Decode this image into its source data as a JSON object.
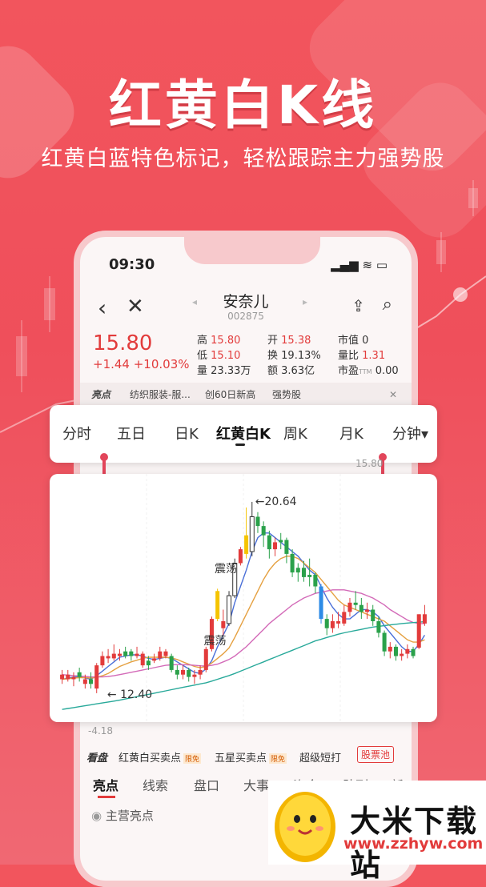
{
  "hero": {
    "title": "红黄白K线",
    "subtitle": "红黄白蓝特色标记，轻松跟踪主力强势股"
  },
  "status_bar": {
    "time": "09:30",
    "icons": "▂▄▆ ≋ ▭"
  },
  "nav": {
    "back_icon": "‹",
    "close_icon": "✕",
    "stock_name": "安奈儿",
    "stock_code": "002875",
    "prev_icon": "◂",
    "next_icon": "▸",
    "share_icon": "⇪",
    "search_icon": "⌕"
  },
  "quote": {
    "price": "15.80",
    "change": "+1.44 +10.03%",
    "high_label": "高",
    "high": "15.80",
    "low_label": "低",
    "low": "15.10",
    "volume_label": "量",
    "volume": "23.33万",
    "open_label": "开",
    "open": "15.38",
    "turnover_label": "换",
    "turnover": "19.13%",
    "amount_label": "额",
    "amount": "3.63亿",
    "mktval_label": "市值",
    "mktval": "0",
    "volratio_label": "量比",
    "volratio": "1.31",
    "pe_label": "市盈",
    "pe_sub": "TTM",
    "pe": "0.00"
  },
  "tags": {
    "highlight": "亮点",
    "tag1": "纺织服装-服...",
    "tag2": "创60日新高",
    "tag3": "强势股",
    "close_icon": "✕"
  },
  "period_tabs": [
    "分时",
    "五日",
    "日K",
    "红黄白K",
    "周K",
    "月K",
    "分钟▾"
  ],
  "chart_edge_labels": {
    "top_right": "15.80",
    "bottom_left": "-4.18"
  },
  "chart_data": {
    "type": "candlestick",
    "annotations": [
      {
        "text": "←20.64"
      },
      {
        "text": "← 12.40"
      },
      {
        "text": "震荡"
      },
      {
        "text": "震荡"
      }
    ],
    "color_key": {
      "up": "#e23b3b",
      "down": "#2aa14a",
      "yellow": "#f5c400",
      "white": "#ffffff",
      "blue": "#2d8be6"
    },
    "ylim": [
      11.5,
      21.5
    ],
    "candles": [
      {
        "o": 13.0,
        "c": 13.2,
        "h": 13.4,
        "l": 12.8,
        "k": "up"
      },
      {
        "o": 13.2,
        "c": 13.0,
        "h": 13.4,
        "l": 12.9,
        "k": "up"
      },
      {
        "o": 13.0,
        "c": 13.1,
        "h": 13.3,
        "l": 12.7,
        "k": "up"
      },
      {
        "o": 13.1,
        "c": 13.3,
        "h": 13.5,
        "l": 12.9,
        "k": "down"
      },
      {
        "o": 13.0,
        "c": 12.8,
        "h": 13.2,
        "l": 12.6,
        "k": "up"
      },
      {
        "o": 12.8,
        "c": 13.0,
        "h": 13.3,
        "l": 12.6,
        "k": "down"
      },
      {
        "o": 12.6,
        "c": 13.6,
        "h": 13.7,
        "l": 12.4,
        "k": "up"
      },
      {
        "o": 13.6,
        "c": 14.0,
        "h": 14.2,
        "l": 13.5,
        "k": "up"
      },
      {
        "o": 14.0,
        "c": 13.9,
        "h": 14.3,
        "l": 13.7,
        "k": "up"
      },
      {
        "o": 13.9,
        "c": 14.1,
        "h": 14.5,
        "l": 13.8,
        "k": "up"
      },
      {
        "o": 14.1,
        "c": 14.0,
        "h": 14.3,
        "l": 13.8,
        "k": "up"
      },
      {
        "o": 14.0,
        "c": 14.2,
        "h": 14.4,
        "l": 13.9,
        "k": "down"
      },
      {
        "o": 14.2,
        "c": 14.0,
        "h": 14.3,
        "l": 13.8,
        "k": "down"
      },
      {
        "o": 14.0,
        "c": 14.1,
        "h": 14.4,
        "l": 13.9,
        "k": "up"
      },
      {
        "o": 14.1,
        "c": 13.6,
        "h": 14.2,
        "l": 13.5,
        "k": "up"
      },
      {
        "o": 13.6,
        "c": 13.8,
        "h": 14.0,
        "l": 13.4,
        "k": "down"
      },
      {
        "o": 13.8,
        "c": 13.9,
        "h": 14.1,
        "l": 13.7,
        "k": "up"
      },
      {
        "o": 13.9,
        "c": 14.2,
        "h": 14.4,
        "l": 13.8,
        "k": "up"
      },
      {
        "o": 14.2,
        "c": 14.0,
        "h": 14.3,
        "l": 13.9,
        "k": "up"
      },
      {
        "o": 14.0,
        "c": 13.4,
        "h": 14.1,
        "l": 13.3,
        "k": "down"
      },
      {
        "o": 13.4,
        "c": 13.2,
        "h": 13.6,
        "l": 13.0,
        "k": "down"
      },
      {
        "o": 13.2,
        "c": 13.4,
        "h": 13.6,
        "l": 13.0,
        "k": "up"
      },
      {
        "o": 13.4,
        "c": 13.1,
        "h": 13.5,
        "l": 12.9,
        "k": "down"
      },
      {
        "o": 13.1,
        "c": 13.2,
        "h": 13.4,
        "l": 12.8,
        "k": "up"
      },
      {
        "o": 13.2,
        "c": 13.4,
        "h": 13.6,
        "l": 13.0,
        "k": "up"
      },
      {
        "o": 13.4,
        "c": 14.3,
        "h": 14.4,
        "l": 13.3,
        "k": "up"
      },
      {
        "o": 14.3,
        "c": 15.6,
        "h": 15.7,
        "l": 14.2,
        "k": "up"
      },
      {
        "o": 15.6,
        "c": 16.8,
        "h": 16.9,
        "l": 15.5,
        "k": "yellow"
      },
      {
        "o": 15.2,
        "c": 15.5,
        "h": 16.0,
        "l": 14.9,
        "k": "up"
      },
      {
        "o": 15.4,
        "c": 16.6,
        "h": 16.8,
        "l": 15.3,
        "k": "white"
      },
      {
        "o": 16.6,
        "c": 18.0,
        "h": 18.2,
        "l": 16.5,
        "k": "white"
      },
      {
        "o": 18.0,
        "c": 18.6,
        "h": 18.7,
        "l": 17.9,
        "k": "up"
      },
      {
        "o": 18.4,
        "c": 19.2,
        "h": 20.4,
        "l": 18.2,
        "k": "yellow"
      },
      {
        "o": 18.5,
        "c": 20.0,
        "h": 20.64,
        "l": 18.3,
        "k": "white"
      },
      {
        "o": 20.0,
        "c": 19.6,
        "h": 20.2,
        "l": 19.3,
        "k": "down"
      },
      {
        "o": 19.6,
        "c": 19.2,
        "h": 19.8,
        "l": 18.7,
        "k": "down"
      },
      {
        "o": 19.2,
        "c": 18.6,
        "h": 19.4,
        "l": 18.2,
        "k": "down"
      },
      {
        "o": 18.6,
        "c": 18.9,
        "h": 19.1,
        "l": 18.3,
        "k": "up"
      },
      {
        "o": 18.9,
        "c": 19.0,
        "h": 19.3,
        "l": 18.6,
        "k": "down"
      },
      {
        "o": 19.0,
        "c": 18.4,
        "h": 19.1,
        "l": 18.0,
        "k": "down"
      },
      {
        "o": 18.4,
        "c": 17.6,
        "h": 18.6,
        "l": 17.4,
        "k": "down"
      },
      {
        "o": 17.6,
        "c": 17.8,
        "h": 18.0,
        "l": 17.2,
        "k": "down"
      },
      {
        "o": 17.8,
        "c": 17.4,
        "h": 18.1,
        "l": 17.2,
        "k": "down"
      },
      {
        "o": 17.4,
        "c": 17.5,
        "h": 18.2,
        "l": 17.0,
        "k": "down"
      },
      {
        "o": 17.5,
        "c": 17.0,
        "h": 17.6,
        "l": 16.7,
        "k": "down"
      },
      {
        "o": 17.0,
        "c": 15.6,
        "h": 17.1,
        "l": 15.4,
        "k": "blue"
      },
      {
        "o": 15.6,
        "c": 15.2,
        "h": 15.8,
        "l": 14.9,
        "k": "down"
      },
      {
        "o": 15.2,
        "c": 15.5,
        "h": 15.8,
        "l": 15.0,
        "k": "up"
      },
      {
        "o": 15.5,
        "c": 15.4,
        "h": 15.9,
        "l": 15.2,
        "k": "up"
      },
      {
        "o": 15.4,
        "c": 15.9,
        "h": 16.2,
        "l": 15.3,
        "k": "up"
      },
      {
        "o": 15.9,
        "c": 16.3,
        "h": 16.5,
        "l": 15.7,
        "k": "up"
      },
      {
        "o": 16.3,
        "c": 16.2,
        "h": 16.8,
        "l": 16.0,
        "k": "down"
      },
      {
        "o": 16.2,
        "c": 15.9,
        "h": 16.5,
        "l": 15.6,
        "k": "down"
      },
      {
        "o": 15.9,
        "c": 16.0,
        "h": 16.3,
        "l": 15.6,
        "k": "up"
      },
      {
        "o": 16.0,
        "c": 15.5,
        "h": 16.2,
        "l": 15.3,
        "k": "down"
      },
      {
        "o": 15.5,
        "c": 15.0,
        "h": 15.7,
        "l": 14.8,
        "k": "down"
      },
      {
        "o": 15.0,
        "c": 14.2,
        "h": 15.1,
        "l": 14.0,
        "k": "down"
      },
      {
        "o": 14.2,
        "c": 14.4,
        "h": 14.6,
        "l": 13.9,
        "k": "up"
      },
      {
        "o": 14.4,
        "c": 14.0,
        "h": 14.5,
        "l": 13.8,
        "k": "down"
      },
      {
        "o": 14.0,
        "c": 14.1,
        "h": 14.3,
        "l": 13.8,
        "k": "up"
      },
      {
        "o": 14.1,
        "c": 14.3,
        "h": 14.5,
        "l": 13.9,
        "k": "up"
      },
      {
        "o": 14.3,
        "c": 14.0,
        "h": 14.4,
        "l": 13.9,
        "k": "down"
      },
      {
        "o": 14.36,
        "c": 15.8,
        "h": 15.8,
        "l": 14.3,
        "k": "up"
      },
      {
        "o": 15.4,
        "c": 15.8,
        "h": 16.2,
        "l": 15.3,
        "k": "up"
      }
    ],
    "ma": [
      {
        "name": "MA5",
        "color": "#4a6fd8",
        "values": [
          13.0,
          13.05,
          13.1,
          13.1,
          13.05,
          13.0,
          13.15,
          13.35,
          13.55,
          13.75,
          13.95,
          14.0,
          14.05,
          14.05,
          14.0,
          13.9,
          13.85,
          13.9,
          13.95,
          13.9,
          13.75,
          13.6,
          13.45,
          13.3,
          13.25,
          13.45,
          13.8,
          14.4,
          14.9,
          15.4,
          16.3,
          17.0,
          17.7,
          18.5,
          19.1,
          19.3,
          19.3,
          19.1,
          18.9,
          18.7,
          18.5,
          18.3,
          18.0,
          17.7,
          17.5,
          17.0,
          16.5,
          16.1,
          15.8,
          15.6,
          15.6,
          15.8,
          16.0,
          16.0,
          15.9,
          15.7,
          15.3,
          15.0,
          14.7,
          14.4,
          14.2,
          14.2,
          14.5,
          14.9
        ]
      },
      {
        "name": "MA10",
        "color": "#e5a040",
        "values": [
          13.0,
          13.02,
          13.05,
          13.07,
          13.07,
          13.05,
          13.08,
          13.15,
          13.25,
          13.4,
          13.55,
          13.65,
          13.75,
          13.82,
          13.9,
          13.95,
          13.95,
          13.95,
          13.95,
          13.92,
          13.85,
          13.75,
          13.65,
          13.55,
          13.5,
          13.55,
          13.7,
          13.9,
          14.1,
          14.35,
          14.8,
          15.3,
          15.8,
          16.3,
          16.8,
          17.3,
          17.7,
          18.0,
          18.2,
          18.3,
          18.3,
          18.2,
          18.0,
          17.8,
          17.6,
          17.3,
          17.0,
          16.7,
          16.4,
          16.2,
          16.1,
          16.0,
          15.9,
          15.8,
          15.7,
          15.6,
          15.5,
          15.3,
          15.1,
          14.9,
          14.7,
          14.6,
          14.6,
          14.7
        ]
      },
      {
        "name": "MA20",
        "color": "#d36ab8",
        "values": [
          13.2,
          13.18,
          13.16,
          13.14,
          13.12,
          13.1,
          13.1,
          13.1,
          13.12,
          13.15,
          13.2,
          13.25,
          13.3,
          13.35,
          13.4,
          13.45,
          13.5,
          13.55,
          13.6,
          13.62,
          13.63,
          13.63,
          13.62,
          13.6,
          13.58,
          13.57,
          13.6,
          13.65,
          13.75,
          13.85,
          14.0,
          14.2,
          14.4,
          14.65,
          14.9,
          15.15,
          15.4,
          15.6,
          15.8,
          16.0,
          16.2,
          16.35,
          16.5,
          16.6,
          16.7,
          16.75,
          16.8,
          16.85,
          16.85,
          16.85,
          16.8,
          16.75,
          16.7,
          16.6,
          16.5,
          16.35,
          16.2,
          16.0,
          15.85,
          15.7,
          15.55,
          15.45,
          15.4,
          15.4
        ]
      },
      {
        "name": "MA60",
        "color": "#28a99a",
        "values": [
          11.7,
          11.74,
          11.78,
          11.82,
          11.86,
          11.9,
          11.94,
          11.98,
          12.02,
          12.06,
          12.1,
          12.15,
          12.2,
          12.25,
          12.3,
          12.35,
          12.4,
          12.45,
          12.5,
          12.55,
          12.6,
          12.65,
          12.7,
          12.75,
          12.8,
          12.85,
          12.92,
          13.0,
          13.08,
          13.16,
          13.25,
          13.35,
          13.45,
          13.55,
          13.65,
          13.75,
          13.85,
          13.95,
          14.05,
          14.15,
          14.25,
          14.35,
          14.45,
          14.55,
          14.65,
          14.72,
          14.8,
          14.87,
          14.94,
          15.0,
          15.05,
          15.1,
          15.15,
          15.2,
          15.25,
          15.28,
          15.31,
          15.34,
          15.37,
          15.4,
          15.42,
          15.44,
          15.46,
          15.48
        ]
      }
    ]
  },
  "section_row": {
    "label": "看盘",
    "item1": "红黄白买卖点",
    "badge1": "限免",
    "item2": "五星买卖点",
    "badge2": "限免",
    "item3": "超级短打",
    "pool": "股票池"
  },
  "bottom_tabs": [
    "亮点",
    "线索",
    "盘口",
    "大事",
    "资金",
    "队列",
    "新"
  ],
  "highlight_row": {
    "icon": "◉",
    "label": "主营亮点"
  },
  "watermark": {
    "title": "大米下载站",
    "url": "www.zzhyw.com"
  }
}
